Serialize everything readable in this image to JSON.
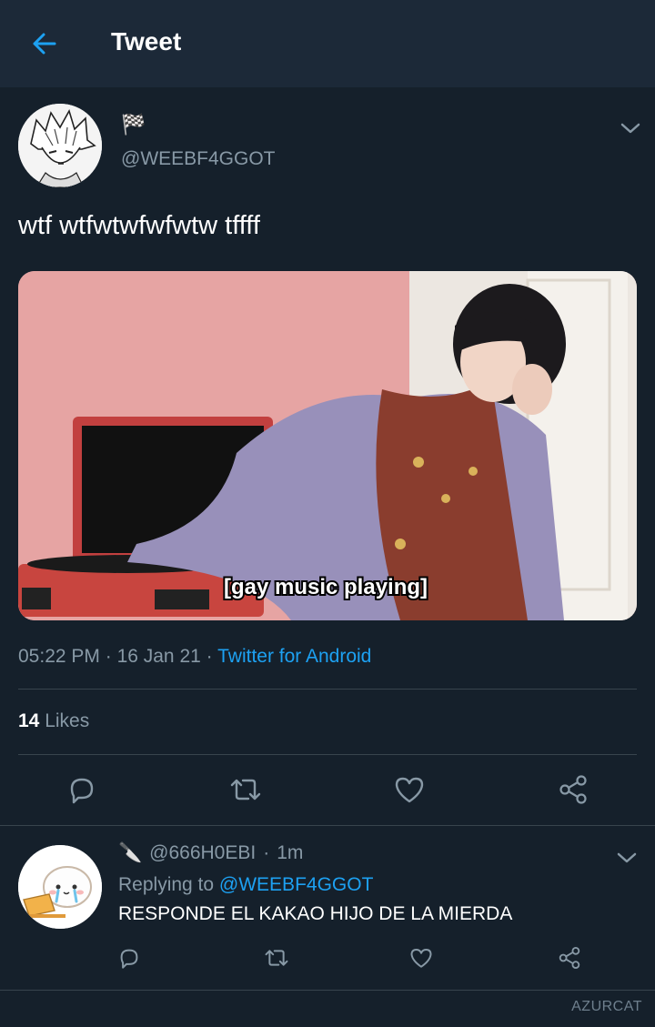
{
  "header": {
    "title": "Tweet"
  },
  "tweet": {
    "display_name": "🏁",
    "handle": "@WEEBF4GGOT",
    "text": "wtf wtfwtwfwfwtw tffff",
    "media_caption": "[gay music playing]",
    "time": "05:22 PM",
    "date": "16 Jan 21",
    "source": "Twitter for Android",
    "likes_count": "14",
    "likes_label": "Likes"
  },
  "reply": {
    "emoji": "🔪",
    "handle": "@666H0EBI",
    "time": "1m",
    "replying_prefix": "Replying to",
    "replying_to": "@WEEBF4GGOT",
    "text": "RESPONDE EL KAKAO HIJO DE LA MIERDA"
  },
  "watermark": "AZURCAT",
  "colors": {
    "background": "#15202b",
    "header": "#1c2938",
    "accent": "#1da1f2",
    "secondary_text": "#8899a6",
    "divider": "#38444d"
  },
  "icons": [
    "back-arrow-icon",
    "chevron-down-icon",
    "reply-icon",
    "retweet-icon",
    "like-icon",
    "share-icon"
  ]
}
